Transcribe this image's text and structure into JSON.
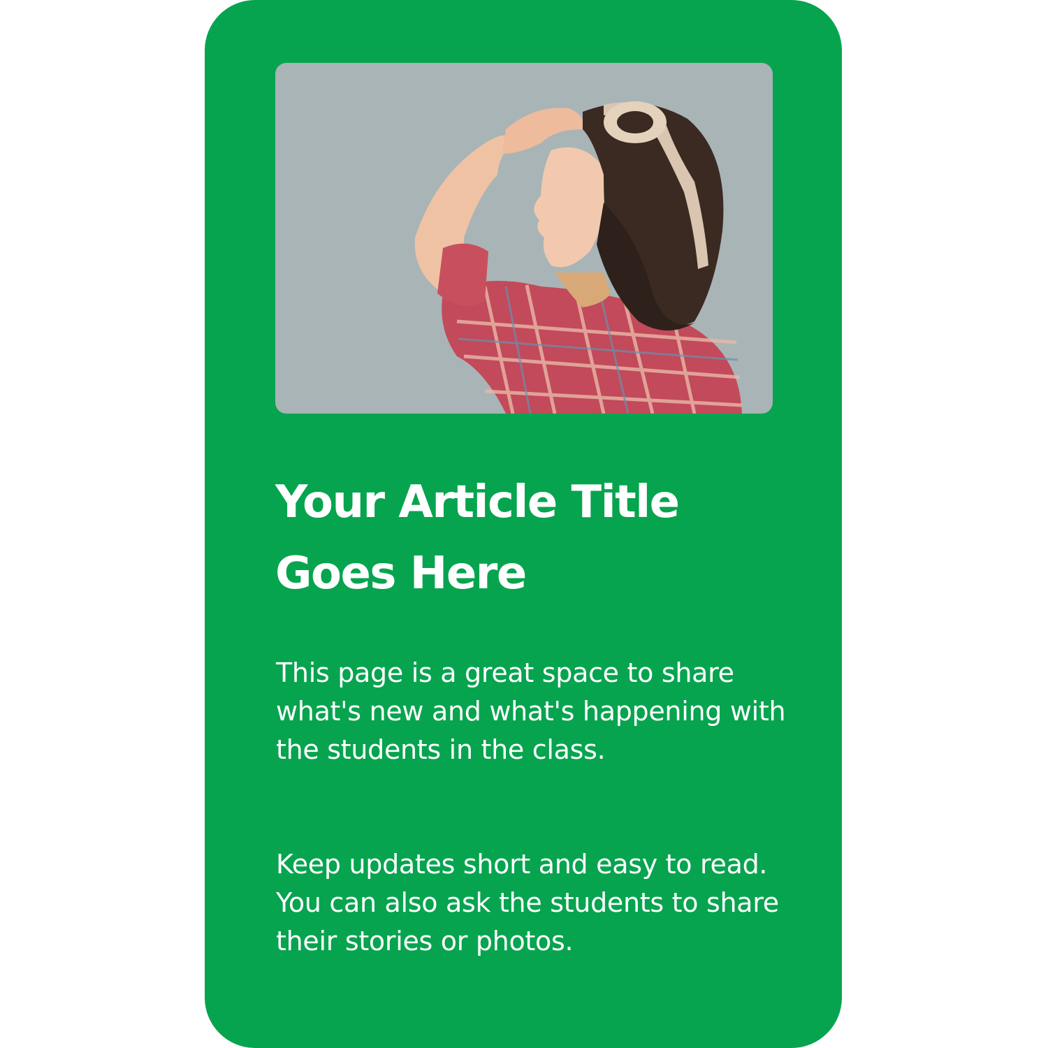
{
  "colors": {
    "card_background": "#07a44f",
    "photo_background": "#a9b4b6",
    "text": "#ffffff"
  },
  "article": {
    "title_line1": "Your Article Title",
    "title_line2": "Goes Here",
    "paragraph1": "This page is a great space to share what's new and what's happening with the students in the class.",
    "paragraph2": "Keep updates short and easy to read. You can also ask the students to share their stories or photos."
  }
}
